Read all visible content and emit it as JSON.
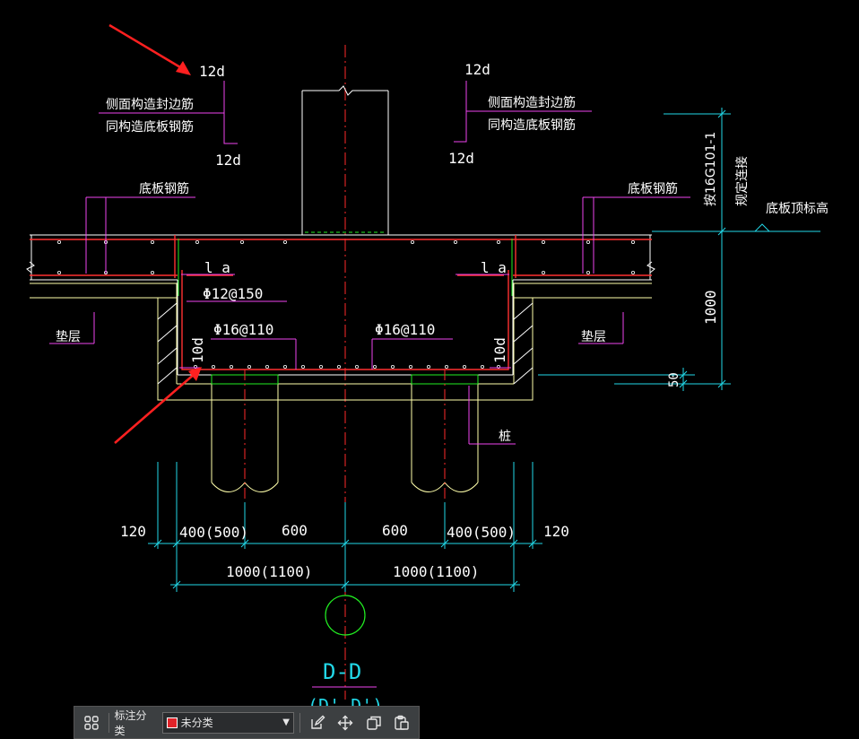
{
  "drawing": {
    "labels": {
      "len_12d": "12d",
      "side_bar_line1": "侧面构造封边筋",
      "side_bar_line2": "同构造底板钢筋",
      "bottom_slab_bar": "底板钢筋",
      "ref_atlas": "按16G101-1",
      "ref_rule": "规定连接",
      "slab_top_elev": "底板顶标高",
      "anchor_la": "l a",
      "bar_12_150": "Φ12@150",
      "bar_16_110": "Φ16@110",
      "len_10d": "10d",
      "cushion": "垫层",
      "pile": "桩",
      "dim_1000": "1000",
      "dim_50": "50"
    },
    "dims_bottom": {
      "d120": "120",
      "d400": "400(500)",
      "d600": "600",
      "d1000": "1000(1100)"
    },
    "section_title": "D-D",
    "section_sub": "(D'-D')"
  },
  "toolbar": {
    "category_label": "标注分类",
    "category_value": "未分类",
    "swatch_color": "#e0242a"
  }
}
